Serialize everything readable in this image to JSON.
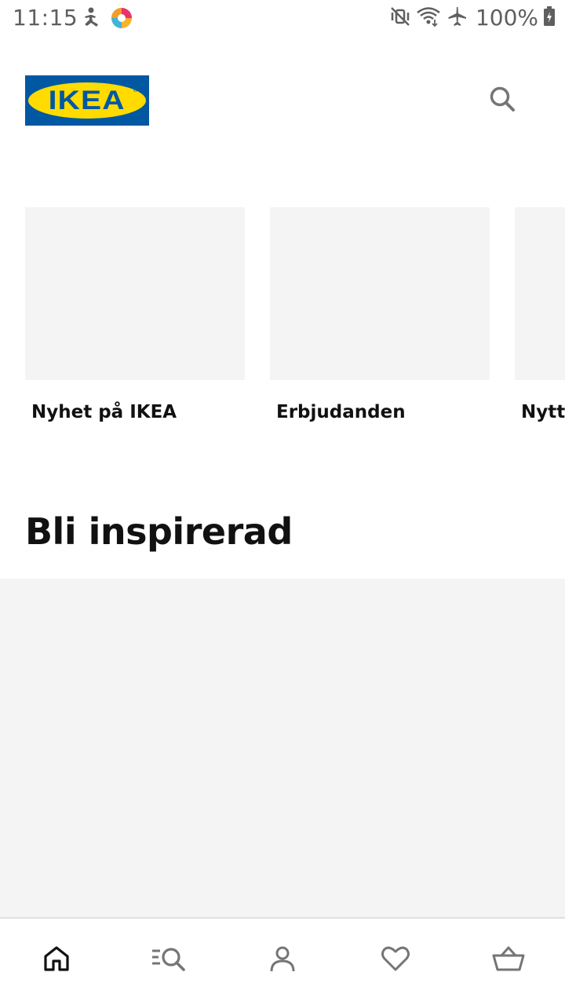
{
  "status_bar": {
    "time": "11:15",
    "battery_text": "100%",
    "left_icons": [
      "accessibility-icon",
      "app-notification-icon"
    ],
    "right_icons": [
      "mute-vibrate-icon",
      "wifi-icon",
      "airplane-mode-icon",
      "battery-charging-icon"
    ]
  },
  "header": {
    "logo_text": "IKEA",
    "logo_colors": {
      "background": "#0058a3",
      "oval": "#ffdb00"
    },
    "search_icon": "search-icon"
  },
  "categories": [
    {
      "label": "Nyhet på IKEA"
    },
    {
      "label": "Erbjudanden"
    },
    {
      "label": "Nytt"
    }
  ],
  "inspiration": {
    "title": "Bli inspirerad"
  },
  "bottom_nav": [
    {
      "icon": "home-icon",
      "active": true
    },
    {
      "icon": "browse-search-icon",
      "active": false
    },
    {
      "icon": "profile-icon",
      "active": false
    },
    {
      "icon": "heart-icon",
      "active": false
    },
    {
      "icon": "basket-icon",
      "active": false
    }
  ]
}
